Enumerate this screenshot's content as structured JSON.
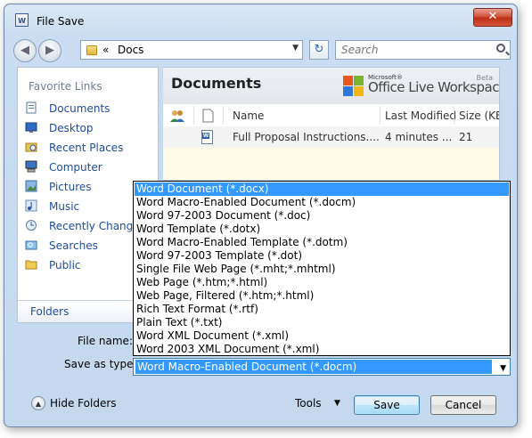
{
  "window": {
    "title": "File Save",
    "close_glyph": "✕"
  },
  "nav": {
    "back_glyph": "◀",
    "forward_glyph": "▶",
    "address_separator": "«",
    "address_path": "Docs",
    "refresh_glyph": "↻",
    "search_placeholder": "Search"
  },
  "sidebar": {
    "header": "Favorite Links",
    "items": [
      {
        "label": "Documents",
        "icon": "documents-icon"
      },
      {
        "label": "Desktop",
        "icon": "desktop-icon"
      },
      {
        "label": "Recent Places",
        "icon": "recent-places-icon"
      },
      {
        "label": "Computer",
        "icon": "computer-icon"
      },
      {
        "label": "Pictures",
        "icon": "pictures-icon"
      },
      {
        "label": "Music",
        "icon": "music-icon"
      },
      {
        "label": "Recently Changed",
        "icon": "recently-changed-icon"
      },
      {
        "label": "Searches",
        "icon": "searches-icon"
      },
      {
        "label": "Public",
        "icon": "public-icon"
      }
    ],
    "folders_label": "Folders"
  },
  "content": {
    "title": "Documents",
    "logo": {
      "microsoft": "Microsoft®",
      "main": "Office Live Workspace",
      "beta": "Beta"
    },
    "columns": {
      "name": "Name",
      "modified": "Last Modified",
      "size": "Size (KE"
    },
    "files": [
      {
        "name": "Full Proposal Instructions....",
        "modified": "4 minutes ...",
        "size": "21"
      }
    ]
  },
  "form": {
    "file_name_label": "File name:",
    "file_name_value": "",
    "save_as_label": "Save as type:",
    "save_as_value": "Word Macro-Enabled Document (*.docm)"
  },
  "save_types": [
    "Word Document (*.docx)",
    "Word Macro-Enabled Document (*.docm)",
    "Word 97-2003 Document (*.doc)",
    "Word Template (*.dotx)",
    "Word Macro-Enabled Template (*.dotm)",
    "Word 97-2003 Template (*.dot)",
    "Single File Web Page (*.mht;*.mhtml)",
    "Web Page (*.htm;*.html)",
    "Web Page, Filtered (*.htm;*.html)",
    "Rich Text Format (*.rtf)",
    "Plain Text (*.txt)",
    "Word XML Document (*.xml)",
    "Word 2003 XML Document (*.xml)"
  ],
  "footer": {
    "hide_folders": "Hide Folders",
    "tools": "Tools",
    "save": "Save",
    "cancel": "Cancel"
  }
}
